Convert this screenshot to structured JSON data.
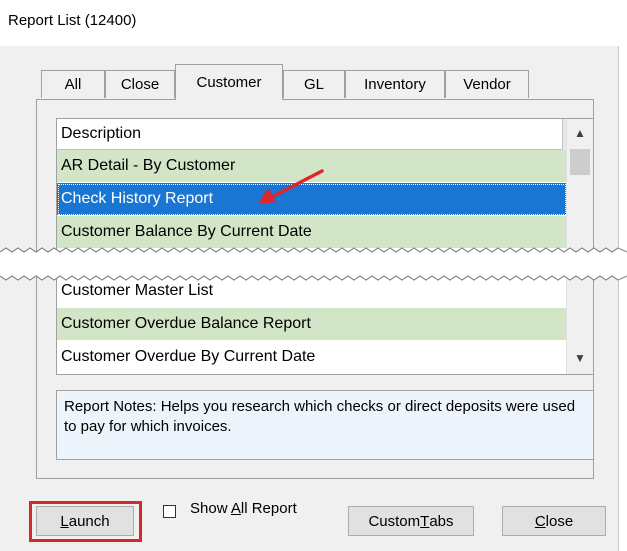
{
  "window": {
    "title": "Report List (12400)"
  },
  "tabs": [
    {
      "label": "All"
    },
    {
      "label": "Close"
    },
    {
      "label": "Customer"
    },
    {
      "label": "GL"
    },
    {
      "label": "Inventory"
    },
    {
      "label": "Vendor"
    }
  ],
  "list": {
    "header": "Description",
    "rows_top": [
      {
        "label": "AR Detail - By Customer",
        "style": "green"
      },
      {
        "label": "Check History Report",
        "style": "selected"
      },
      {
        "label": "Customer Balance By Current Date",
        "style": "green"
      }
    ],
    "rows_bottom": [
      {
        "label": "Customer Master List",
        "style": "white"
      },
      {
        "label": "Customer Overdue Balance Report",
        "style": "green"
      },
      {
        "label": "Customer Overdue By Current Date",
        "style": "white"
      }
    ]
  },
  "notes": {
    "text": "Report Notes:  Helps you research which checks or direct deposits were used to pay for which invoices."
  },
  "buttons": {
    "launch_pre": "",
    "launch_ul": "L",
    "launch_post": "aunch",
    "show_all_pre": "Show ",
    "show_all_ul": "A",
    "show_all_post": "ll Report",
    "custom_pre": "Custom ",
    "custom_ul": "T",
    "custom_post": "abs",
    "close_pre": "",
    "close_ul": "C",
    "close_post": "lose"
  },
  "colors": {
    "selected": "#1976d2",
    "green_row": "#d3e5c7",
    "highlight_box": "#d42a2a",
    "arrow": "#e0262b"
  }
}
